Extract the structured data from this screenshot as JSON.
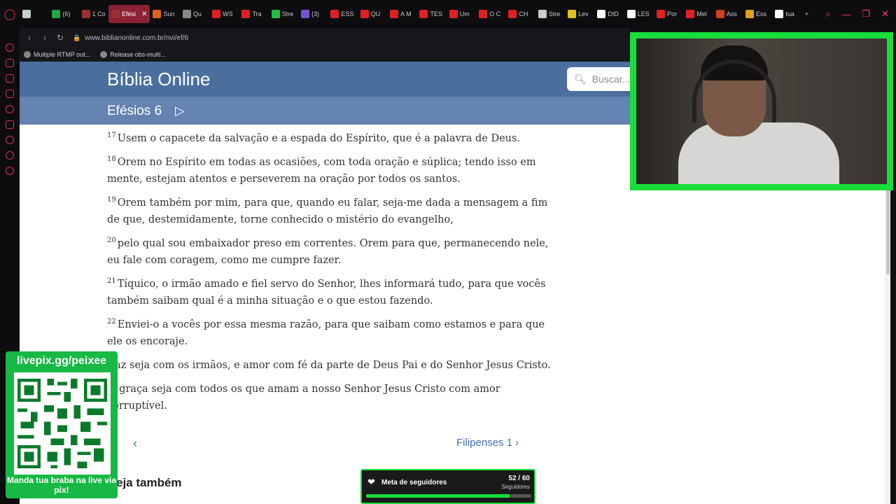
{
  "browser": {
    "tabs": [
      {
        "label": "",
        "icon": "mail-icon"
      },
      {
        "label": "(6)",
        "icon": "whatsapp-icon"
      },
      {
        "label": "1 Co",
        "icon": "bible-icon"
      },
      {
        "label": "Efési",
        "icon": "bible-icon",
        "active": true
      },
      {
        "label": "Sun",
        "icon": "sun-icon"
      },
      {
        "label": "Qu",
        "icon": "t-icon"
      },
      {
        "label": "WS",
        "icon": "youtube-icon"
      },
      {
        "label": "Tra",
        "icon": "youtube-icon"
      },
      {
        "label": "Stre",
        "icon": "kick-icon"
      },
      {
        "label": "(3)",
        "icon": "chat-icon"
      },
      {
        "label": "ESS",
        "icon": "youtube-icon"
      },
      {
        "label": "QU",
        "icon": "youtube-icon"
      },
      {
        "label": "A M",
        "icon": "youtube-icon"
      },
      {
        "label": "TES",
        "icon": "youtube-icon"
      },
      {
        "label": "Um",
        "icon": "youtube-icon"
      },
      {
        "label": "O C",
        "icon": "youtube-icon"
      },
      {
        "label": "CH",
        "icon": "youtube-icon"
      },
      {
        "label": "Stre",
        "icon": "obs-icon"
      },
      {
        "label": "Lev",
        "icon": "bookmark-icon"
      },
      {
        "label": "DID",
        "icon": "doc-icon"
      },
      {
        "label": "LES",
        "icon": "doc-icon"
      },
      {
        "label": "Por",
        "icon": "youtube-icon"
      },
      {
        "label": "Mel",
        "icon": "youtube-icon"
      },
      {
        "label": "Ass",
        "icon": "clock-icon"
      },
      {
        "label": "Ess",
        "icon": "shield-icon"
      },
      {
        "label": "tua",
        "icon": "google-icon"
      }
    ],
    "new_tab": "+",
    "url": "www.biblianonline.com.br/nvi/ef/6",
    "bookmarks": [
      {
        "label": "Multiple RTMP out..."
      },
      {
        "label": "Release obs-multi..."
      }
    ]
  },
  "site": {
    "title": "Bíblia Online",
    "search_placeholder": "Buscar...",
    "chapter": "Efésios 6"
  },
  "verses": [
    {
      "num": "17",
      "text": "Usem o capacete da salvação e a espada do Espírito, que é a palavra de Deus."
    },
    {
      "num": "18",
      "text": "Orem no Espírito em todas as ocasiões, com toda oração e súplica; tendo isso em mente, estejam atentos e perseverem na oração por todos os santos."
    },
    {
      "num": "19",
      "text": "Orem também por mim, para que, quando eu falar, seja-me dada a mensagem a fim de que, destemidamente, torne conhecido o mistério do evangelho,"
    },
    {
      "num": "20",
      "text": "pelo qual sou embaixador preso em correntes. Orem para que, permanecendo nele, eu fale com coragem, como me cumpre fazer."
    },
    {
      "num": "21",
      "text": "Tíquico, o irmão amado e fiel servo do Senhor, lhes informará tudo, para que vocês também saibam qual é a minha situação e o que estou fazendo."
    },
    {
      "num": "22",
      "text": "Enviei-o a vocês por essa mesma razão, para que saibam como estamos e para que ele os encoraje."
    },
    {
      "num": "",
      "text": "Paz seja com os irmãos, e amor com fé da parte de Deus Pai e do Senhor Jesus Cristo."
    },
    {
      "num": "",
      "text": "A graça seja com todos os que amam a nosso Senhor Jesus Cristo com amor corruptível."
    }
  ],
  "navigation": {
    "prev_label": "‹",
    "next_label": "Filipenses 1",
    "see_also": "eja também"
  },
  "overlays": {
    "livepix_url": "livepix.gg/peixee",
    "livepix_cta": "Manda tua braba na live via pix!",
    "goal_title": "Meta de seguidores",
    "goal_count": "52 / 60",
    "goal_sub": "Seguidores",
    "goal_progress": 0.867
  }
}
